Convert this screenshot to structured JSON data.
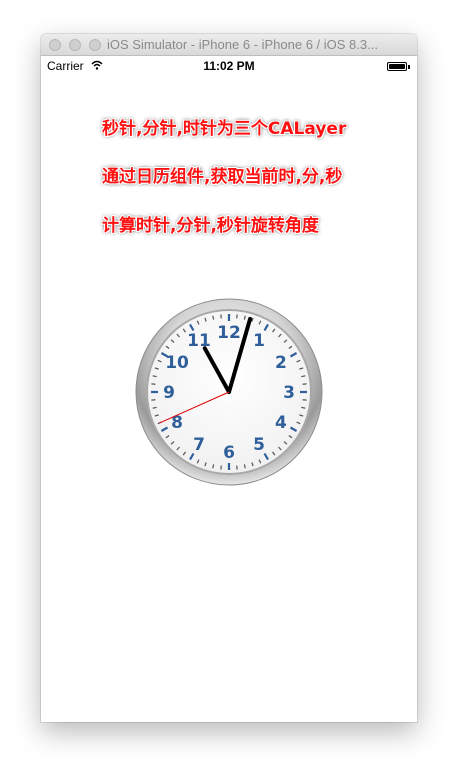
{
  "window": {
    "title": "iOS Simulator - iPhone 6 - iPhone 6 / iOS 8.3..."
  },
  "status_bar": {
    "carrier": "Carrier",
    "time": "11:02 PM",
    "wifi_icon": "wifi-icon",
    "battery_icon": "battery-icon"
  },
  "content": {
    "lines": [
      "秒针,分针,时针为三个CALayer",
      "通过日历组件,获取当前时,分,秒",
      "计算时针,分针,秒针旋转角度"
    ],
    "caption_color": "#ff1010"
  },
  "clock": {
    "numerals": [
      "12",
      "1",
      "2",
      "3",
      "4",
      "5",
      "6",
      "7",
      "8",
      "9",
      "10",
      "11"
    ],
    "hour": 11,
    "minute": 2,
    "second": 41,
    "numeral_color": "#2f5f9a",
    "second_hand_color": "#e00000"
  }
}
